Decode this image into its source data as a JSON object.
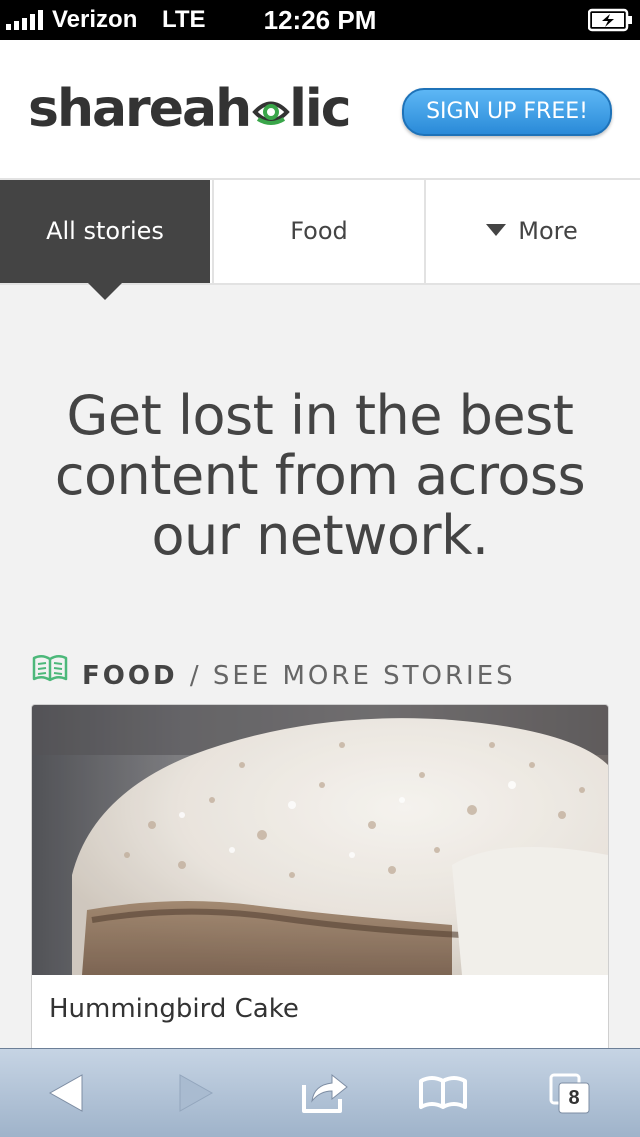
{
  "status_bar": {
    "carrier": "Verizon",
    "network": "LTE",
    "time": "12:26 PM"
  },
  "header": {
    "logo_text_left": "shareah",
    "logo_text_right": "lic",
    "signup_label": "SIGN UP FREE!"
  },
  "tabs": [
    {
      "label": "All stories",
      "active": true
    },
    {
      "label": "Food",
      "active": false
    },
    {
      "label": "More",
      "active": false
    }
  ],
  "headline": "Get lost in the best content from across our network.",
  "section": {
    "category": "FOOD",
    "separator": "/",
    "see_more": "SEE MORE STORIES",
    "icon": "book-icon"
  },
  "card": {
    "title": "Hummingbird Cake"
  },
  "toolbar": {
    "tabs_count": "8",
    "icons": [
      "back-arrow-icon",
      "forward-arrow-icon",
      "share-icon",
      "bookmarks-icon",
      "tabs-icon"
    ]
  },
  "colors": {
    "accent_blue": "#2a8ad8",
    "logo_green": "#3aa64a",
    "dark_tab": "#444444",
    "book_icon": "#4cb87a"
  }
}
